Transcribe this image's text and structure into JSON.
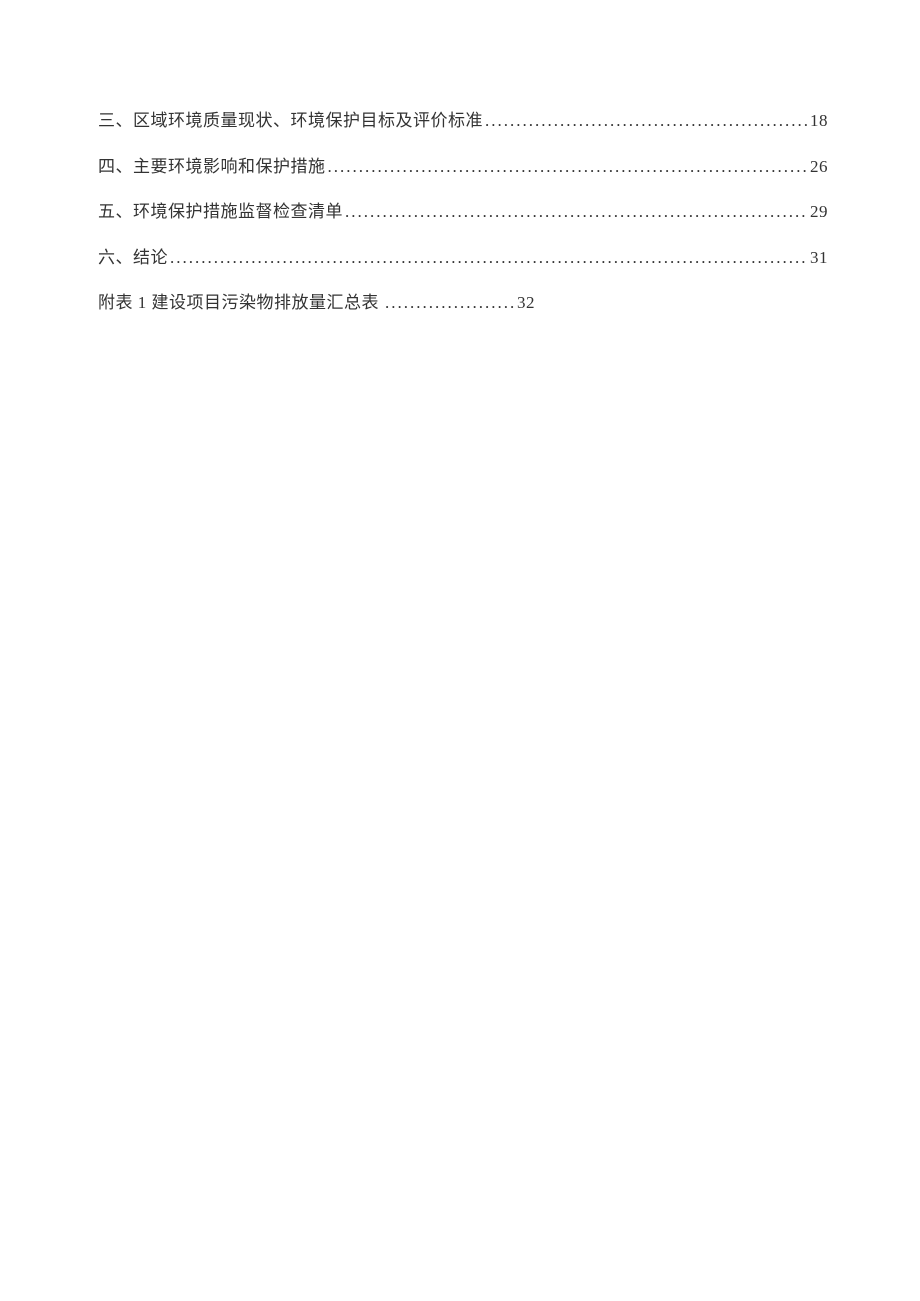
{
  "toc": {
    "entries": [
      {
        "title": "三、区域环境质量现状、环境保护目标及评价标准",
        "page": "18"
      },
      {
        "title": "四、主要环境影响和保护措施",
        "page": "26"
      },
      {
        "title": "五、环境保护措施监督检查清单",
        "page": "29"
      },
      {
        "title": "六、结论",
        "page": "31"
      }
    ],
    "appendix": {
      "title": "附表 1 建设项目污染物排放量汇总表",
      "page": "32"
    }
  }
}
